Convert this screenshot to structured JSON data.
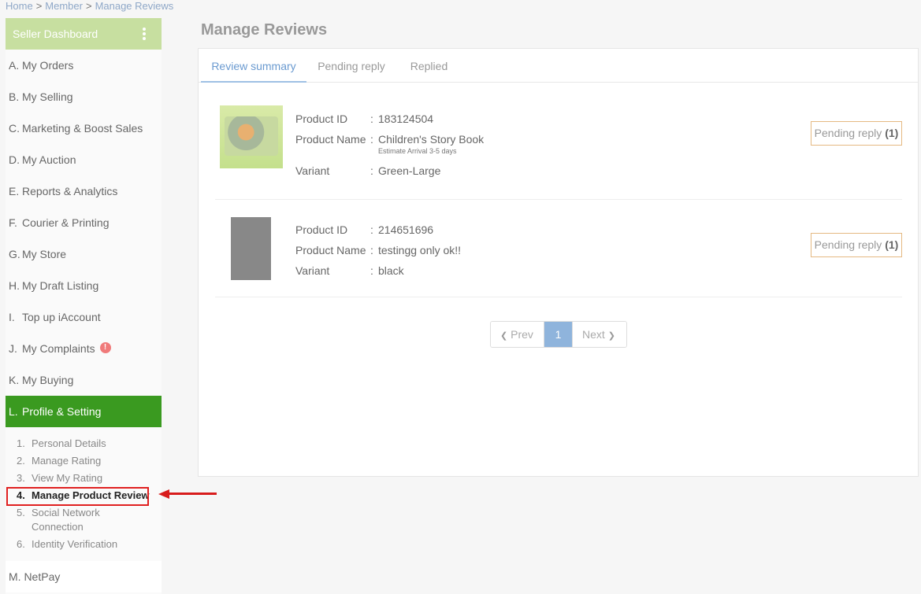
{
  "breadcrumb": {
    "home": "Home",
    "member": "Member",
    "current": "Manage Reviews",
    "sep": ">"
  },
  "sidebar": {
    "header": "Seller Dashboard",
    "items": [
      {
        "letter": "A.",
        "label": "My Orders"
      },
      {
        "letter": "B.",
        "label": "My Selling"
      },
      {
        "letter": "C.",
        "label": "Marketing & Boost Sales"
      },
      {
        "letter": "D.",
        "label": "My Auction"
      },
      {
        "letter": "E.",
        "label": "Reports & Analytics"
      },
      {
        "letter": "F.",
        "label": "Courier & Printing"
      },
      {
        "letter": "G.",
        "label": "My Store"
      },
      {
        "letter": "H.",
        "label": "My Draft Listing"
      },
      {
        "letter": "I.",
        "label": "Top up iAccount"
      },
      {
        "letter": "J.",
        "label": "My Complaints",
        "alert": "!"
      },
      {
        "letter": "K.",
        "label": "My Buying"
      },
      {
        "letter": "L.",
        "label": "Profile & Setting"
      }
    ],
    "submenu": [
      {
        "num": "1.",
        "label": "Personal Details"
      },
      {
        "num": "2.",
        "label": "Manage Rating"
      },
      {
        "num": "3.",
        "label": "View My Rating"
      },
      {
        "num": "4.",
        "label": "Manage Product Review"
      },
      {
        "num": "5.",
        "label": "Social Network Connection"
      },
      {
        "num": "6.",
        "label": "Identity Verification"
      }
    ],
    "netpay": "M. NetPay"
  },
  "page_title": "Manage Reviews",
  "tabs": [
    "Review summary",
    "Pending reply",
    "Replied"
  ],
  "labels": {
    "product_id": "Product ID",
    "product_name": "Product Name",
    "variant": "Variant",
    "colon": ":"
  },
  "products": [
    {
      "id": "183124504",
      "name": "Children's Story Book",
      "note": "Estimate Arrival 3-5 days",
      "variant": "Green-Large",
      "status": "Pending reply",
      "count": "(1)"
    },
    {
      "id": "214651696",
      "name": "testingg only ok!!",
      "variant": "black",
      "status": "Pending reply",
      "count": "(1)"
    }
  ],
  "pager": {
    "prev": "Prev",
    "current": "1",
    "next": "Next"
  }
}
